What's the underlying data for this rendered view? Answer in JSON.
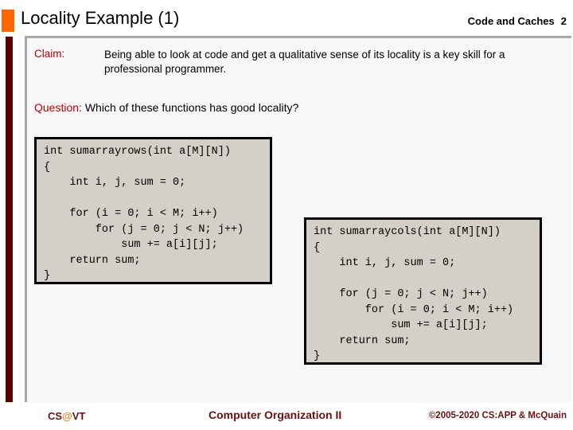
{
  "header": {
    "title": "Locality Example (1)",
    "bullet_color": "#ff6600",
    "topic": "Code and Caches",
    "page_number": "2"
  },
  "body": {
    "claim_label": "Claim:",
    "claim_text": "Being able to look at code and get a qualitative sense of its locality is a key skill for a professional programmer.",
    "question_label": "Question:",
    "question_text": " Which of these functions has good locality?",
    "accent_color": "#c00000"
  },
  "code_blocks": [
    {
      "name": "sumarrayrows",
      "code": "int sumarrayrows(int a[M][N])\n{\n    int i, j, sum = 0;\n\n    for (i = 0; i < M; i++)\n        for (j = 0; j < N; j++)\n            sum += a[i][j];\n    return sum;\n}"
    },
    {
      "name": "sumarraycols",
      "code": "int sumarraycols(int a[M][N])\n{\n    int i, j, sum = 0;\n\n    for (j = 0; j < N; j++)\n        for (i = 0; i < M; i++)\n            sum += a[i][j];\n    return sum;\n}"
    }
  ],
  "footer": {
    "logo_prefix": "CS",
    "logo_at": "@",
    "logo_suffix": "VT",
    "course": "Computer Organization II",
    "copyright": "©2005-2020 CS:APP & McQuain",
    "color": "#6b1010",
    "at_color": "#e08a1e"
  }
}
